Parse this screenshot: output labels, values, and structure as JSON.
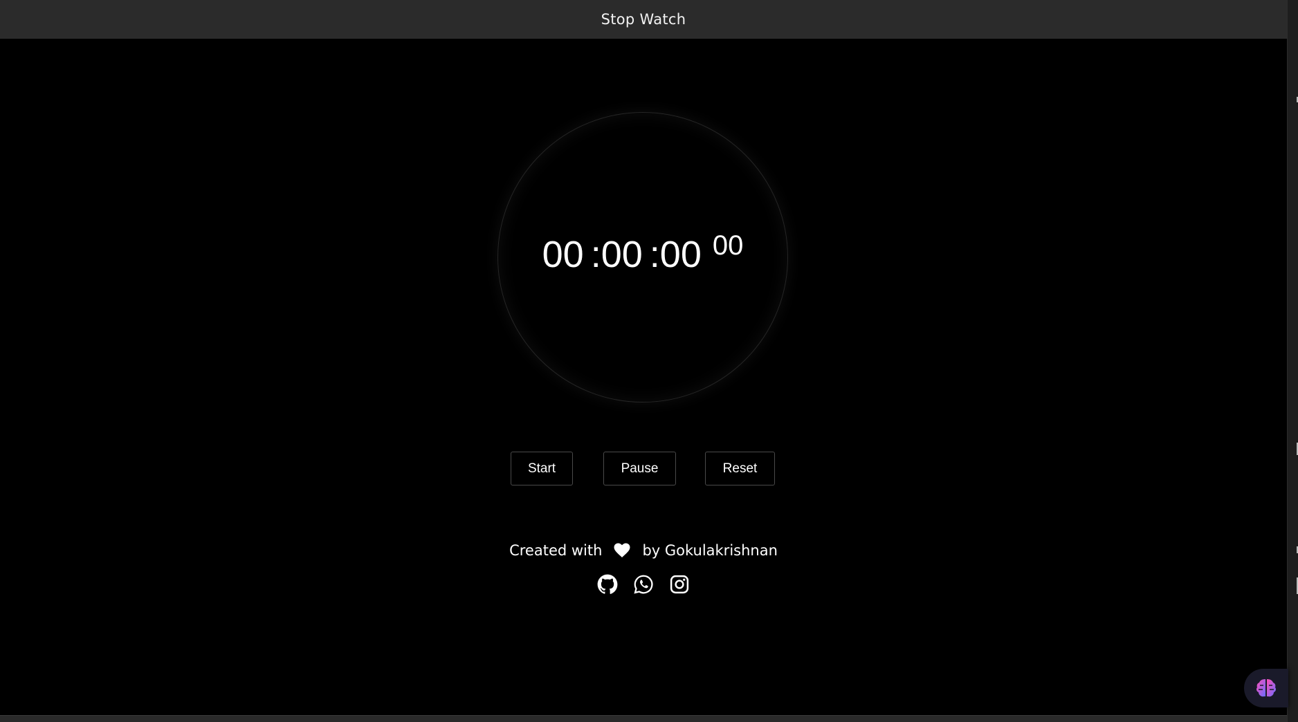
{
  "header": {
    "title": "Stop Watch"
  },
  "stopwatch": {
    "hours": "00",
    "minutes": ":00",
    "seconds": ":00",
    "centiseconds": "00"
  },
  "controls": {
    "start_label": "Start",
    "pause_label": "Pause",
    "reset_label": "Reset"
  },
  "footer": {
    "created_with": "Created with",
    "by_author": "by Gokulakrishnan",
    "heart_icon": "heart-icon",
    "socials": [
      "github-icon",
      "whatsapp-icon",
      "instagram-icon"
    ]
  },
  "badge": {
    "icon": "brain-icon"
  },
  "colors": {
    "background": "#000000",
    "header": "#2b2b2b",
    "text": "#ffffff",
    "button_border": "#4a4a4a"
  }
}
